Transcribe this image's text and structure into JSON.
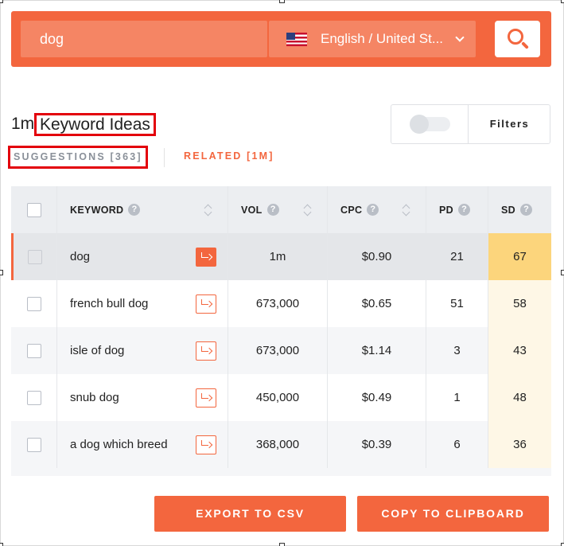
{
  "search": {
    "query": "dog",
    "language": "English / United St...",
    "search_button_icon": "search-icon"
  },
  "heading": {
    "count": "1m",
    "title": "Keyword Ideas"
  },
  "tabs": {
    "suggestions": "SUGGESTIONS [363]",
    "related": "RELATED [1M]"
  },
  "controls": {
    "toggle_on": false,
    "filters_label": "Filters"
  },
  "table": {
    "headers": {
      "keyword": "KEYWORD",
      "vol": "VOL",
      "cpc": "CPC",
      "pd": "PD",
      "sd": "SD",
      "help": "?"
    },
    "rows": [
      {
        "keyword": "dog",
        "vol": "1m",
        "cpc": "$0.90",
        "pd": "21",
        "sd": "67",
        "selected": true
      },
      {
        "keyword": "french bull dog",
        "vol": "673,000",
        "cpc": "$0.65",
        "pd": "51",
        "sd": "58",
        "selected": false
      },
      {
        "keyword": "isle of dog",
        "vol": "673,000",
        "cpc": "$1.14",
        "pd": "3",
        "sd": "43",
        "selected": false
      },
      {
        "keyword": "snub dog",
        "vol": "450,000",
        "cpc": "$0.49",
        "pd": "1",
        "sd": "48",
        "selected": false
      },
      {
        "keyword": "a dog which breed",
        "vol": "368,000",
        "cpc": "$0.39",
        "pd": "6",
        "sd": "36",
        "selected": false
      }
    ]
  },
  "actions": {
    "export": "EXPORT TO CSV",
    "copy": "COPY TO CLIPBOARD"
  },
  "colors": {
    "accent": "#f3663e",
    "sd_highlight": "#fcd57c",
    "sd_light": "#fef7e6"
  }
}
